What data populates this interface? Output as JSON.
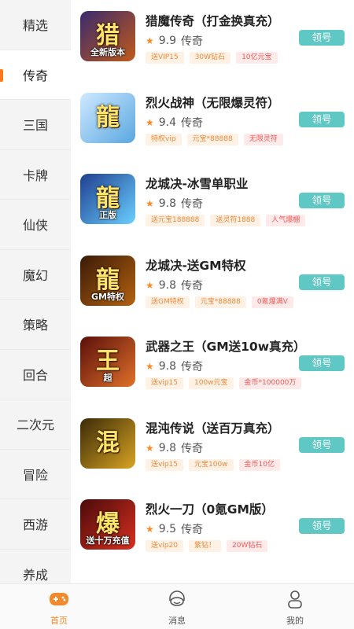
{
  "sidebar": {
    "active_index": 1,
    "categories": [
      "精选",
      "传奇",
      "三国",
      "卡牌",
      "仙侠",
      "魔幻",
      "策略",
      "回合",
      "二次元",
      "冒险",
      "西游",
      "养成"
    ]
  },
  "games": [
    {
      "name": "猎魔传奇（打金换真充）",
      "score": "9.9",
      "genre": "传奇",
      "tags": [
        "送VIP15",
        "30W钻石",
        "10亿元宝"
      ],
      "button": "领号",
      "thumb_glyph": "猎",
      "thumb_caption": "全新版本",
      "thumb_colors": [
        "#3a2a6e",
        "#c05a1a"
      ]
    },
    {
      "name": "烈火战神（无限爆灵符）",
      "score": "9.4",
      "genre": "传奇",
      "tags": [
        "特权vip",
        "元宝*88888",
        "无限灵符"
      ],
      "button": "领号",
      "thumb_glyph": "龍",
      "thumb_caption": "",
      "thumb_colors": [
        "#cfe9ff",
        "#5aa7e0"
      ]
    },
    {
      "name": "龙城决-冰雪单职业",
      "score": "9.8",
      "genre": "传奇",
      "tags": [
        "送元宝188888",
        "送灵符1888",
        "人气爆棚"
      ],
      "button": "领号",
      "thumb_glyph": "龍",
      "thumb_caption": "正版",
      "thumb_colors": [
        "#1f3e8f",
        "#6ad0ff"
      ]
    },
    {
      "name": "龙城决-送GM特权",
      "score": "9.8",
      "genre": "传奇",
      "tags": [
        "送GM特权",
        "元宝*88888",
        "0氪爆满V"
      ],
      "button": "领号",
      "thumb_glyph": "龍",
      "thumb_caption": "GM特权",
      "thumb_colors": [
        "#3a1a08",
        "#b5620f"
      ]
    },
    {
      "name": "武器之王（GM送10w真充）",
      "score": "9.8",
      "genre": "传奇",
      "tags": [
        "送vip15",
        "100w元宝",
        "金币*100000万"
      ],
      "button": "领号",
      "thumb_glyph": "王",
      "thumb_caption": "超",
      "thumb_colors": [
        "#5a0f0a",
        "#e0702a"
      ]
    },
    {
      "name": "混沌传说（送百万真充）",
      "score": "9.8",
      "genre": "传奇",
      "tags": [
        "送vip15",
        "元宝100w",
        "金币10亿"
      ],
      "button": "领号",
      "thumb_glyph": "混",
      "thumb_caption": "",
      "thumb_colors": [
        "#3a2a08",
        "#d9a422"
      ]
    },
    {
      "name": "烈火一刀（0氪GM版）",
      "score": "9.5",
      "genre": "传奇",
      "tags": [
        "送vip20",
        "紫钻！",
        "20W钻石"
      ],
      "button": "领号",
      "thumb_glyph": "爆",
      "thumb_caption": "送十万充值",
      "thumb_colors": [
        "#4a0a0a",
        "#d83020"
      ]
    }
  ],
  "bottom_nav": [
    {
      "label": "首页",
      "icon": "gamepad-icon",
      "active": true
    },
    {
      "label": "消息",
      "icon": "headset-icon",
      "active": false
    },
    {
      "label": "我的",
      "icon": "person-icon",
      "active": false
    }
  ],
  "colors": {
    "accent": "#ff7a1a",
    "button": "#5fc8c4",
    "star": "#ff8a1f"
  }
}
